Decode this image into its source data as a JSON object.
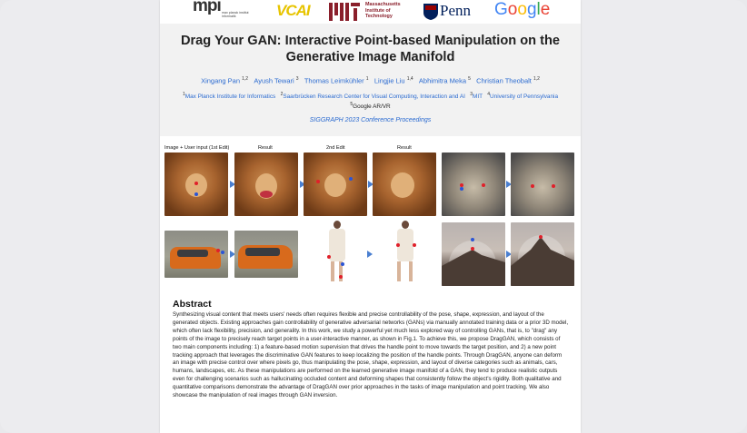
{
  "logos": {
    "mpi": "mpi",
    "mpi_sub": "max planck institut informatik",
    "vcai": "VCAI",
    "mit": "MIT",
    "mit_text": "Massachusetts Institute of Technology",
    "penn": "Penn",
    "google": "Google"
  },
  "title": "Drag Your GAN: Interactive Point-based Manipulation on the Generative Image Manifold",
  "authors": [
    {
      "name": "Xingang Pan",
      "sup": "1,2"
    },
    {
      "name": "Ayush Tewari",
      "sup": "3"
    },
    {
      "name": "Thomas Leimkühler",
      "sup": "1"
    },
    {
      "name": "Lingjie Liu",
      "sup": "1,4"
    },
    {
      "name": "Abhimitra Meka",
      "sup": "5"
    },
    {
      "name": "Christian Theobalt",
      "sup": "1,2"
    }
  ],
  "affiliations": {
    "a1": "Max Planck Institute for Informatics",
    "a1_sup": "1",
    "a2": "Saarbrücken Research Center for Visual Computing, Interaction and AI",
    "a2_sup": "2",
    "a3": "MIT",
    "a3_sup": "3",
    "a4": "University of Pennsylvania",
    "a4_sup": "4",
    "a5": "Google AR/VR",
    "a5_sup": "5"
  },
  "venue": "SIGGRAPH 2023 Conference Proceedings",
  "figure": {
    "captions": [
      "Image + User input (1st Edit)",
      "Result",
      "2nd Edit",
      "Result"
    ],
    "colors": {
      "handle": "#e0202a",
      "target": "#2b55d6",
      "arrow": "#4a7fd0"
    }
  },
  "abstract": {
    "heading": "Abstract",
    "text": "Synthesizing visual content that meets users' needs often requires flexible and precise controllability of the pose, shape, expression, and layout of the generated objects. Existing approaches gain controllability of generative adversarial networks (GANs) via manually annotated training data or a prior 3D model, which often lack flexibility, precision, and generality. In this work, we study a powerful yet much less explored way of controlling GANs, that is, to \"drag\" any points of the image to precisely reach target points in a user-interactive manner, as shown in Fig.1. To achieve this, we propose DragGAN, which consists of two main components including: 1) a feature-based motion supervision that drives the handle point to move towards the target position, and 2) a new point tracking approach that leverages the discriminative GAN features to keep localizing the position of the handle points. Through DragGAN, anyone can deform an image with precise control over where pixels go, thus manipulating the pose, shape, expression, and layout of diverse categories such as animals, cars, humans, landscapes, etc. As these manipulations are performed on the learned generative image manifold of a GAN, they tend to produce realistic outputs even for challenging scenarios such as hallucinating occluded content and deforming shapes that consistently follow the object's rigidity. Both qualitative and quantitative comparisons demonstrate the advantage of DragGAN over prior approaches in the tasks of image manipulation and point tracking. We also showcase the manipulation of real images through GAN inversion."
  }
}
